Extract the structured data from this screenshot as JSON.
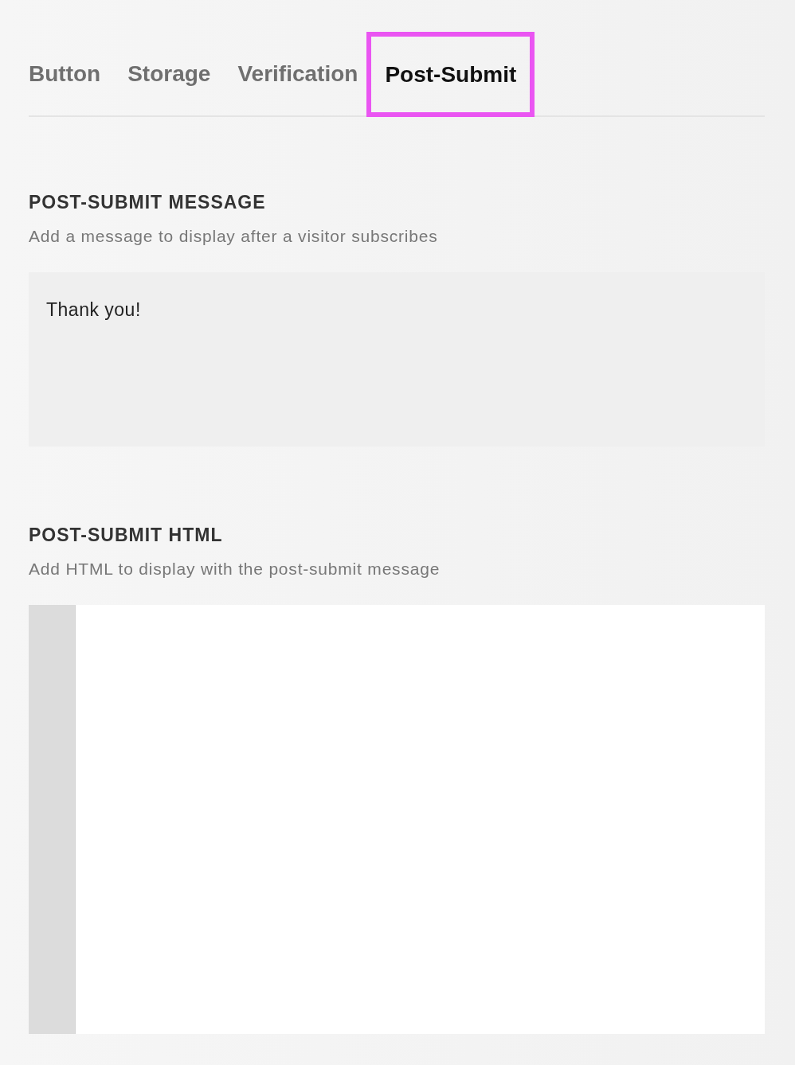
{
  "tabs": [
    {
      "label": "Button",
      "selected": false,
      "highlighted": false
    },
    {
      "label": "Storage",
      "selected": false,
      "highlighted": false
    },
    {
      "label": "Verification",
      "selected": false,
      "highlighted": false
    },
    {
      "label": "Post-Submit",
      "selected": true,
      "highlighted": true
    }
  ],
  "sections": [
    {
      "kind": "text",
      "heading": "POST-SUBMIT MESSAGE",
      "description": "Add a message to display after a visitor subscribes",
      "value": "Thank you!"
    },
    {
      "kind": "code",
      "heading": "POST-SUBMIT HTML",
      "description": "Add HTML to display with the post-submit message"
    }
  ]
}
